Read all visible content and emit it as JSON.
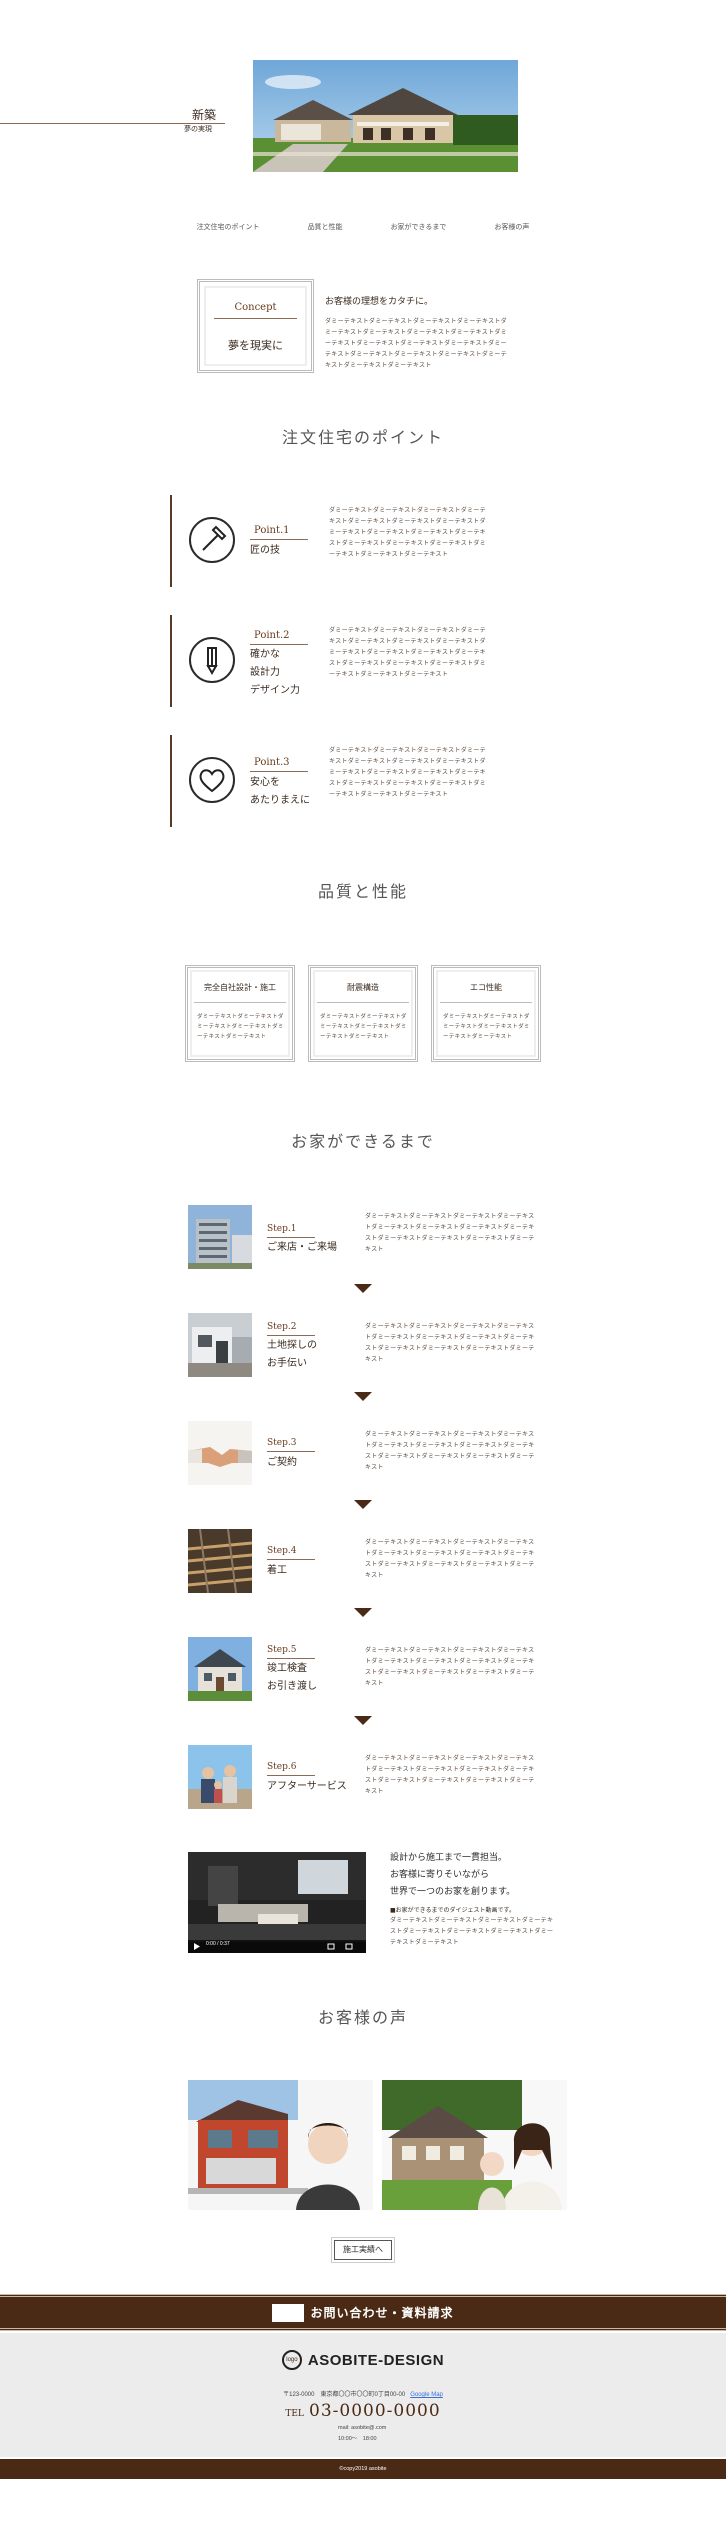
{
  "hero": {
    "title": "新築",
    "subtitle": "夢の実現"
  },
  "nav": {
    "items": [
      "注文住宅のポイント",
      "品質と性能",
      "お家ができるまで",
      "お客様の声"
    ]
  },
  "concept": {
    "label": "Concept",
    "sub": "夢を現実に",
    "heading": "お客様の理想をカタチに。",
    "text": "ダミーテキストダミーテキストダミーテキストダミーテキストダミーテキストダミーテキストダミーテキストダミーテキストダミーテキストダミーテキストダミーテキストダミーテキストダミーテキストダミーテキストダミーテキストダミーテキストダミーテキストダミーテキストダミーテキスト"
  },
  "points": {
    "title": "注文住宅のポイント",
    "items": [
      {
        "label": "Point.1",
        "sub": "匠の技",
        "icon": "hammer-icon",
        "text": "ダミーテキストダミーテキストダミーテキストダミーテキストダミーテキストダミーテキストダミーテキストダミーテキストダミーテキストダミーテキストダミーテキストダミーテキストダミーテキストダミーテキストダミーテキストダミーテキストダミーテキスト"
      },
      {
        "label": "Point.2",
        "sub": "確かな\n設計力\nデザイン力",
        "icon": "pencil-icon",
        "text": "ダミーテキストダミーテキストダミーテキストダミーテキストダミーテキストダミーテキストダミーテキストダミーテキストダミーテキストダミーテキストダミーテキストダミーテキストダミーテキストダミーテキストダミーテキストダミーテキストダミーテキスト"
      },
      {
        "label": "Point.3",
        "sub": "安心を\nあたりまえに",
        "icon": "heart-icon",
        "text": "ダミーテキストダミーテキストダミーテキストダミーテキストダミーテキストダミーテキストダミーテキストダミーテキストダミーテキストダミーテキストダミーテキストダミーテキストダミーテキストダミーテキストダミーテキストダミーテキストダミーテキスト"
      }
    ]
  },
  "quality": {
    "title": "品質と性能",
    "items": [
      {
        "title": "完全自社設計・施工",
        "text": "ダミーテキストダミーテキストダミーテキストダミーテキストダミーテキストダミーテキスト"
      },
      {
        "title": "耐震構造",
        "text": "ダミーテキストダミーテキストダミーテキストダミーテキストダミーテキストダミーテキスト"
      },
      {
        "title": "エコ性能",
        "text": "ダミーテキストダミーテキストダミーテキストダミーテキストダミーテキストダミーテキスト"
      }
    ]
  },
  "steps": {
    "title": "お家ができるまで",
    "items": [
      {
        "label": "Step.1",
        "sub": "ご来店・ご来場",
        "text": "ダミーテキストダミーテキストダミーテキストダミーテキストダミーテキストダミーテキストダミーテキストダミーテキストダミーテキストダミーテキストダミーテキストダミーテキスト"
      },
      {
        "label": "Step.2",
        "sub": "土地探しの\nお手伝い",
        "text": "ダミーテキストダミーテキストダミーテキストダミーテキストダミーテキストダミーテキストダミーテキストダミーテキストダミーテキストダミーテキストダミーテキストダミーテキスト"
      },
      {
        "label": "Step.3",
        "sub": "ご契約",
        "text": "ダミーテキストダミーテキストダミーテキストダミーテキストダミーテキストダミーテキストダミーテキストダミーテキストダミーテキストダミーテキストダミーテキストダミーテキスト"
      },
      {
        "label": "Step.4",
        "sub": "着工",
        "text": "ダミーテキストダミーテキストダミーテキストダミーテキストダミーテキストダミーテキストダミーテキストダミーテキストダミーテキストダミーテキストダミーテキストダミーテキスト"
      },
      {
        "label": "Step.5",
        "sub": "竣工検査\nお引き渡し",
        "text": "ダミーテキストダミーテキストダミーテキストダミーテキストダミーテキストダミーテキストダミーテキストダミーテキストダミーテキストダミーテキストダミーテキストダミーテキスト"
      },
      {
        "label": "Step.6",
        "sub": "アフターサービス",
        "text": "ダミーテキストダミーテキストダミーテキストダミーテキストダミーテキストダミーテキストダミーテキストダミーテキストダミーテキストダミーテキストダミーテキストダミーテキスト"
      }
    ]
  },
  "video_section": {
    "heading": "設計から施工まで一貫担当。\nお客様に寄りそいながら\n世界で一つのお家を創ります。",
    "note": "■お家ができるまでのダイジェスト動画です。",
    "text": "ダミーテキストダミーテキストダミーテキストダミーテキストダミーテキストダミーテキストダミーテキストダミーテキストダミーテキスト",
    "time": "0:00 / 0:37"
  },
  "voices": {
    "title": "お客様の声",
    "button": "施工実績へ"
  },
  "contact": {
    "label": "お問い合わせ・資料請求"
  },
  "footer": {
    "logo_mark": "logo",
    "logo_text": "ASOBITE-DESIGN",
    "address": "〒123-0000　東京都〇〇市〇〇町0丁目00-00",
    "map_link": "Google Map",
    "tel_label": "TEL",
    "tel": "03-0000-0000",
    "mail": "mail: asobite@.com",
    "hours": "10:00～　18:00",
    "copyright": "©copy2019 asobite"
  },
  "colors": {
    "accent": "#4a2a14",
    "label": "#6b3a1c",
    "line": "#8b6b55"
  }
}
